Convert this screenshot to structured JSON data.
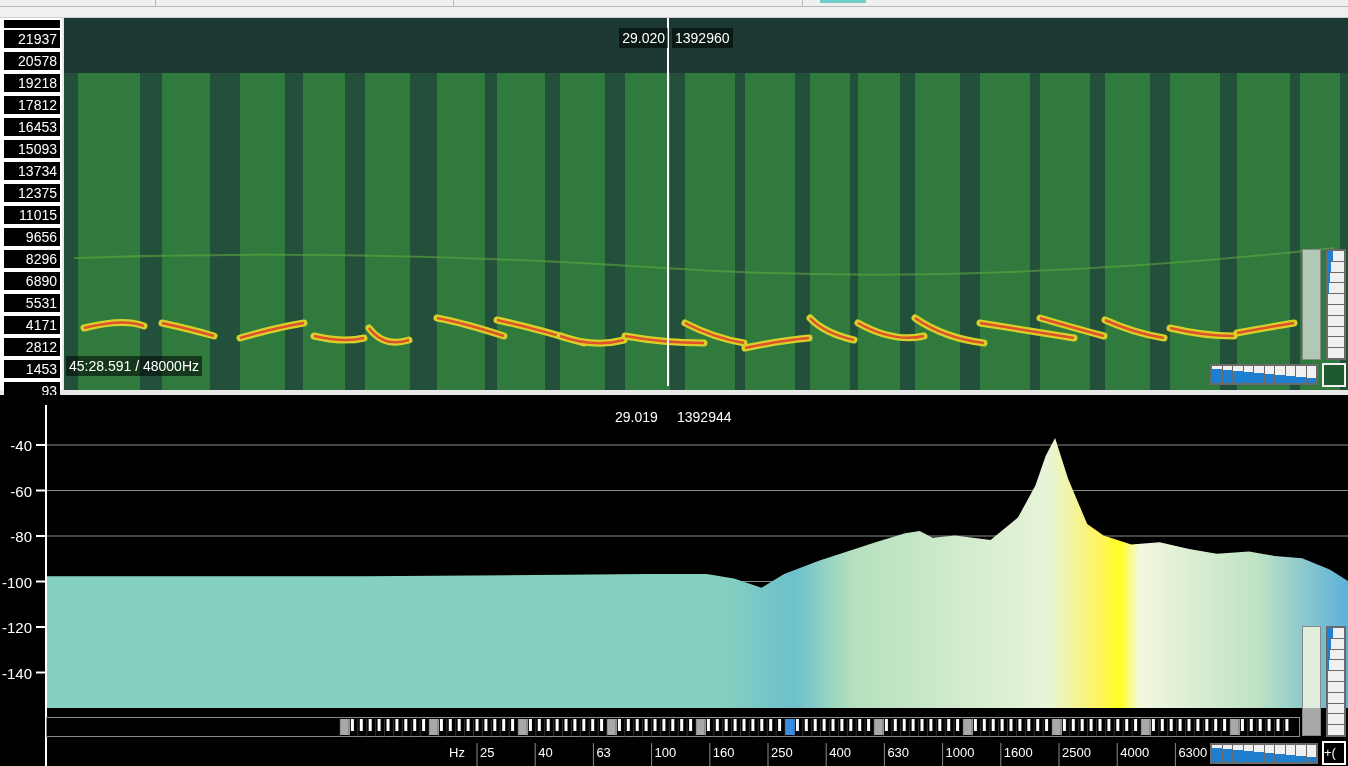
{
  "spectrogram": {
    "frequency_labels": [
      "21937",
      "20578",
      "19218",
      "17812",
      "16453",
      "15093",
      "13734",
      "12375",
      "11015",
      "9656",
      "8296",
      "6890",
      "5531",
      "4171",
      "2812",
      "1453",
      "93"
    ],
    "cursor_time": "29.020",
    "cursor_sample": "1392960",
    "position_readout": "45:28.591 / 48000Hz",
    "slider": {
      "level": 1
    }
  },
  "spectrum": {
    "cursor_time": "29.019",
    "cursor_sample": "1392944",
    "corner_button": "+(",
    "slider": {
      "level": 0.25
    },
    "level_labels": [
      "-40",
      "-60",
      "-80",
      "-100",
      "-120",
      "-140"
    ],
    "frequency_axis": {
      "unit": "Hz",
      "labels": [
        "25",
        "40",
        "63",
        "100",
        "160",
        "250",
        "400",
        "630",
        "1000",
        "1600",
        "2500",
        "4000",
        "6300"
      ]
    }
  }
}
